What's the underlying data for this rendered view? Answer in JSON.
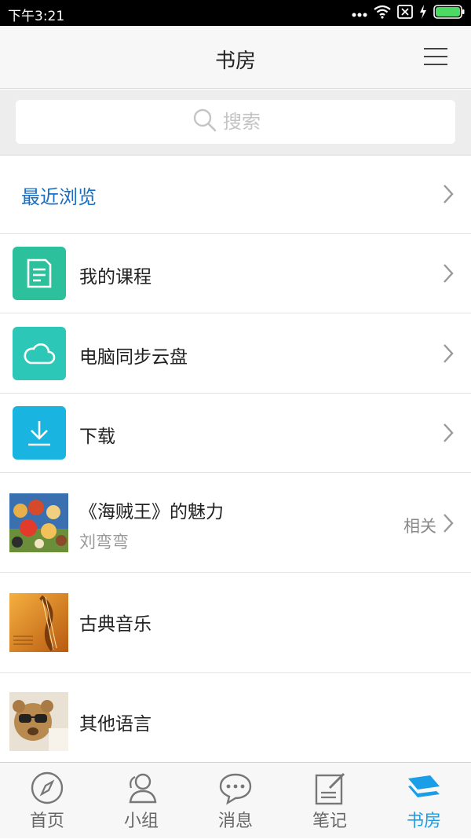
{
  "status_bar": {
    "time": "下午3:21"
  },
  "header": {
    "title": "书房"
  },
  "search": {
    "placeholder": "搜索"
  },
  "recent": {
    "label": "最近浏览"
  },
  "menu_items": [
    {
      "label": "我的课程",
      "icon": "document-icon",
      "color": "#2cc09c"
    },
    {
      "label": "电脑同步云盘",
      "icon": "cloud-icon",
      "color": "#2cc7b7"
    },
    {
      "label": "下载",
      "icon": "download-icon",
      "color": "#1ab4e0"
    }
  ],
  "books": [
    {
      "title": "《海贼王》的魅力",
      "author": "刘弯弯",
      "action": "相关"
    },
    {
      "title": "古典音乐"
    },
    {
      "title": "其他语言"
    }
  ],
  "tabs": [
    {
      "label": "首页",
      "icon": "compass-icon"
    },
    {
      "label": "小组",
      "icon": "group-icon"
    },
    {
      "label": "消息",
      "icon": "message-icon"
    },
    {
      "label": "笔记",
      "icon": "note-icon"
    },
    {
      "label": "书房",
      "icon": "bookshelf-icon",
      "active": true
    }
  ],
  "colors": {
    "accent": "#1a9ee8",
    "link": "#1a6fc0"
  }
}
